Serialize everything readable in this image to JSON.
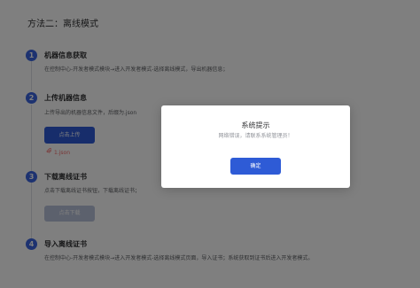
{
  "section_title": "方法二：离线模式",
  "steps": [
    {
      "num": "1",
      "title": "机器信息获取",
      "desc": "在控制中心-开发者模式模块→进入开发者模式-选择离线模式，导出机器信息；"
    },
    {
      "num": "2",
      "title": "上传机器信息",
      "desc": "上传导出的机器信息文件，后缀为.json",
      "button": "点击上传",
      "file": "1.json"
    },
    {
      "num": "3",
      "title": "下载离线证书",
      "desc": "点击下载离线证书按钮，下载离线证书；",
      "button": "点击下载"
    },
    {
      "num": "4",
      "title": "导入离线证书",
      "desc": "在控制中心-开发者模式模块→进入开发者模式-选择离线模式页面，导入证书；系统获取到证书后进入开发者模式。"
    }
  ],
  "dialog": {
    "title": "系统提示",
    "message": "网络错误，请联系系统管理员！",
    "ok_label": "确定"
  },
  "colors": {
    "primary": "#2e5bd6",
    "step_badge": "#3a64e0",
    "file_link": "#f56c6c",
    "disabled_button": "#b9c3da"
  }
}
